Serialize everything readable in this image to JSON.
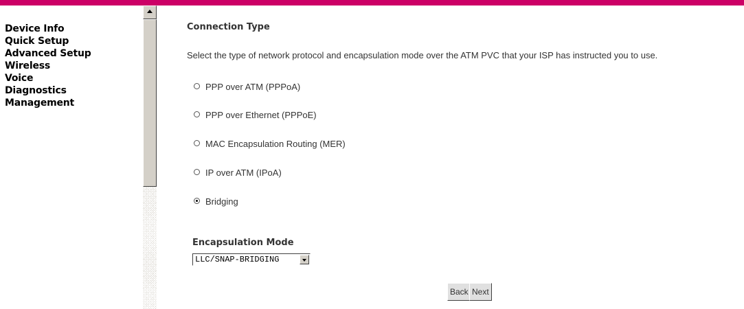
{
  "sidebar": {
    "items": [
      {
        "label": "Device Info"
      },
      {
        "label": "Quick Setup"
      },
      {
        "label": "Advanced Setup"
      },
      {
        "label": "Wireless"
      },
      {
        "label": "Voice"
      },
      {
        "label": "Diagnostics"
      },
      {
        "label": "Management"
      }
    ]
  },
  "main": {
    "title": "Connection Type",
    "description": "Select the type of network protocol and encapsulation mode over the ATM PVC that your ISP has instructed you to use.",
    "options": [
      {
        "label": "PPP over ATM (PPPoA)",
        "selected": false
      },
      {
        "label": "PPP over Ethernet (PPPoE)",
        "selected": false
      },
      {
        "label": "MAC Encapsulation Routing (MER)",
        "selected": false
      },
      {
        "label": "IP over ATM (IPoA)",
        "selected": false
      },
      {
        "label": "Bridging",
        "selected": true
      }
    ],
    "encapsulation_label": "Encapsulation Mode",
    "encapsulation_value": "LLC/SNAP-BRIDGING"
  },
  "buttons": {
    "back": "Back",
    "next": "Next"
  },
  "colors": {
    "brand_bar": "#cc0066"
  }
}
